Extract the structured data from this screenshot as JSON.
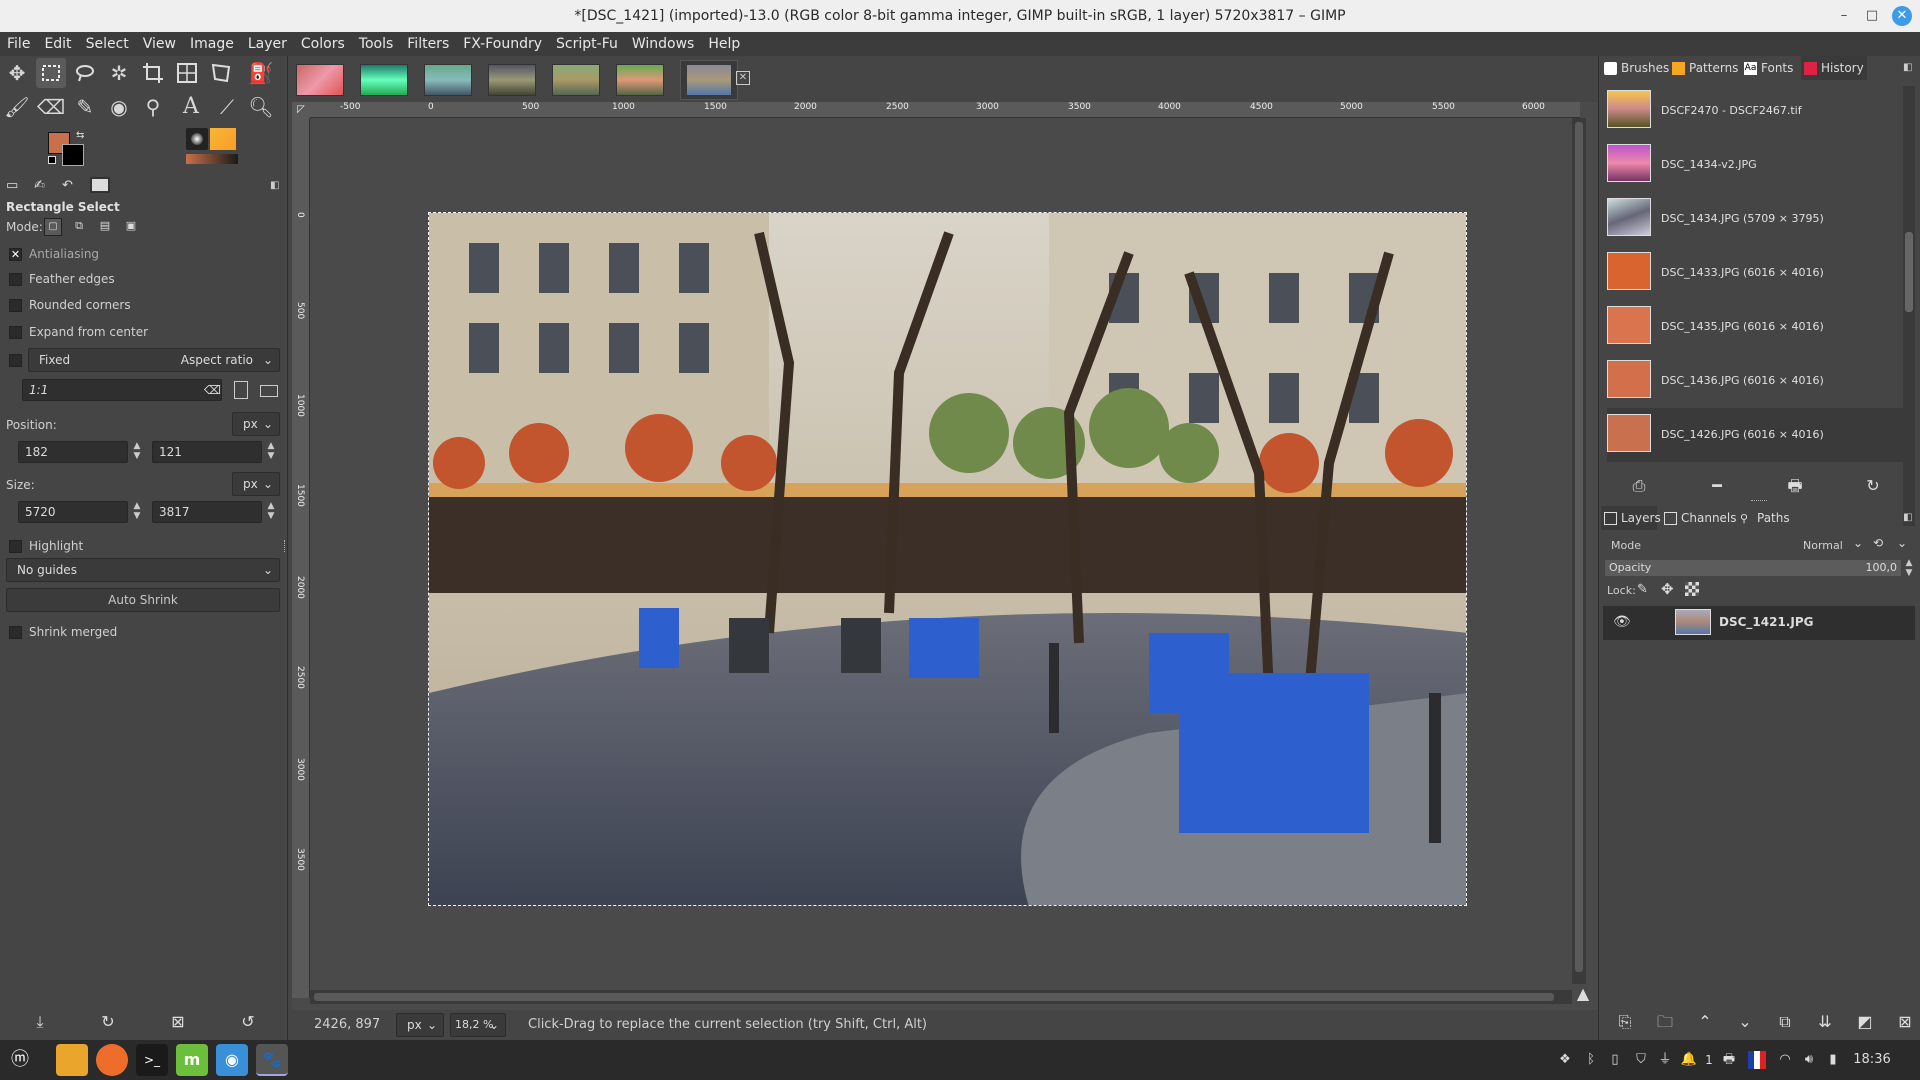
{
  "window": {
    "title": "*[DSC_1421] (imported)-13.0 (RGB color 8-bit gamma integer, GIMP built-in sRGB, 1 layer) 5720x3817 – GIMP",
    "minimize": "–",
    "maximize": "□",
    "close": "✕"
  },
  "menu": [
    "File",
    "Edit",
    "Select",
    "View",
    "Image",
    "Layer",
    "Colors",
    "Tools",
    "Filters",
    "FX-Foundry",
    "Script-Fu",
    "Windows",
    "Help"
  ],
  "tool_options": {
    "title": "Rectangle Select",
    "mode_label": "Mode:",
    "antialiasing": "Antialiasing",
    "feather": "Feather edges",
    "rounded": "Rounded corners",
    "expand": "Expand from center",
    "fixed": "Fixed",
    "fixed_mode": "Aspect ratio",
    "ratio": "1:1",
    "position_label": "Position:",
    "position_unit": "px",
    "pos_x": "182",
    "pos_y": "121",
    "size_label": "Size:",
    "size_unit": "px",
    "size_w": "5720",
    "size_h": "3817",
    "highlight": "Highlight",
    "guides": "No guides",
    "auto_shrink": "Auto Shrink",
    "shrink_merged": "Shrink merged"
  },
  "rulers": {
    "h_ticks": [
      "-500",
      "0",
      "500",
      "1000",
      "1500",
      "2000",
      "2500",
      "3000",
      "3500",
      "4000",
      "4500",
      "5000",
      "5500",
      "6000"
    ],
    "v_ticks": [
      "0",
      "500",
      "1000",
      "1500",
      "2000",
      "2500",
      "3000",
      "3500"
    ]
  },
  "status": {
    "coords": "2426, 897",
    "unit": "px",
    "zoom": "18,2 %",
    "message": "Click-Drag to replace the current selection (try Shift, Ctrl, Alt)"
  },
  "right_tabs": {
    "brushes": "Brushes",
    "patterns": "Patterns",
    "fonts": "Fonts",
    "history": "History"
  },
  "history_items": [
    "DSCF2470 - DSCF2467.tif",
    "DSC_1434-v2.JPG",
    "DSC_1434.JPG (5709 × 3795)",
    "DSC_1433.JPG (6016 × 4016)",
    "DSC_1435.JPG (6016 × 4016)",
    "DSC_1436.JPG (6016 × 4016)",
    "DSC_1426.JPG (6016 × 4016)"
  ],
  "layers_tabs": {
    "layers": "Layers",
    "channels": "Channels",
    "paths": "Paths"
  },
  "layers_panel": {
    "mode_label": "Mode",
    "mode_value": "Normal",
    "opacity_label": "Opacity",
    "opacity_value": "100,0",
    "lock_label": "Lock:",
    "layer_name": "DSC_1421.JPG"
  },
  "clock": "18:36",
  "tray_count": "1",
  "colors": {
    "fg": "#c8704a",
    "bg": "#000000",
    "accent": "#3e9be8"
  }
}
